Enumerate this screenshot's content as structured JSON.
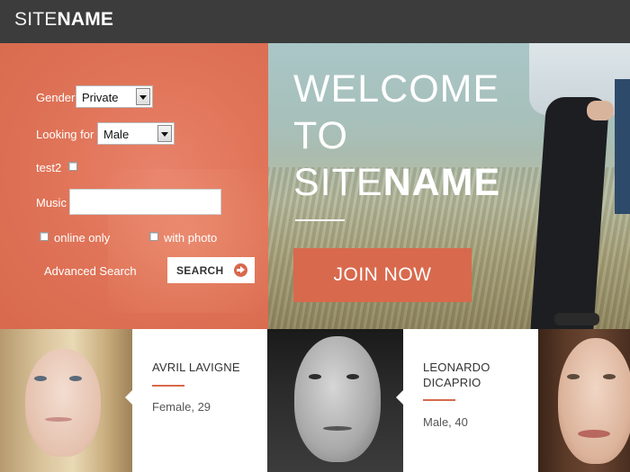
{
  "header": {
    "logo_thin": "SITE",
    "logo_bold": "NAME"
  },
  "search": {
    "gender_label": "Gender",
    "gender_value": "Private",
    "looking_label": "Looking for",
    "looking_value": "Male",
    "test2_label": "test2",
    "music_label": "Music",
    "music_value": "",
    "online_label": "online only",
    "photo_label": "with photo",
    "advanced_label": "Advanced Search",
    "search_button": "SEARCH"
  },
  "hero": {
    "line1": "WELCOME",
    "line2": "TO",
    "line3_thin": "SITE",
    "line3_bold": "NAME",
    "join_button": "JOIN NOW"
  },
  "profiles": [
    {
      "name_line1": "AVRIL LAVIGNE",
      "name_line2": "",
      "detail": "Female, 29"
    },
    {
      "name_line1": "LEONARDO",
      "name_line2": "DICAPRIO",
      "detail": "Male, 40"
    }
  ],
  "colors": {
    "accent": "#d8694d",
    "header_bg": "#3c3c3c"
  },
  "icons": {
    "search_button_icon": "arrow-right-circle-icon",
    "select_icon": "chevron-down-icon"
  }
}
